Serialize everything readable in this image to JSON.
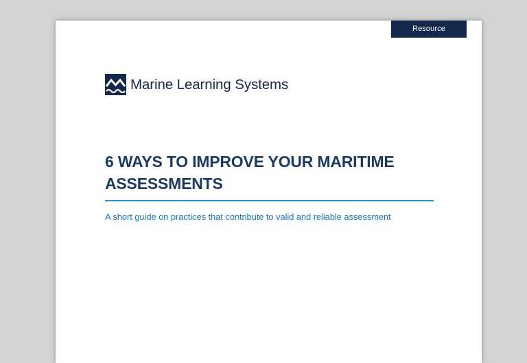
{
  "page": {
    "tag": "Resource",
    "brand": {
      "logo_icon": "waves-logo-icon",
      "name": "Marine Learning Systems"
    },
    "title": "6 WAYS TO IMPROVE YOUR MARITIME ASSESSMENTS",
    "subtitle": "A short guide on practices that contribute to valid and reliable assessment"
  },
  "colors": {
    "background": "#d3d3d3",
    "page": "#ffffff",
    "navy": "#14284b",
    "title": "#1d3a63",
    "accent_rule": "#2a8cc0",
    "subtitle": "#1f7ab3"
  }
}
